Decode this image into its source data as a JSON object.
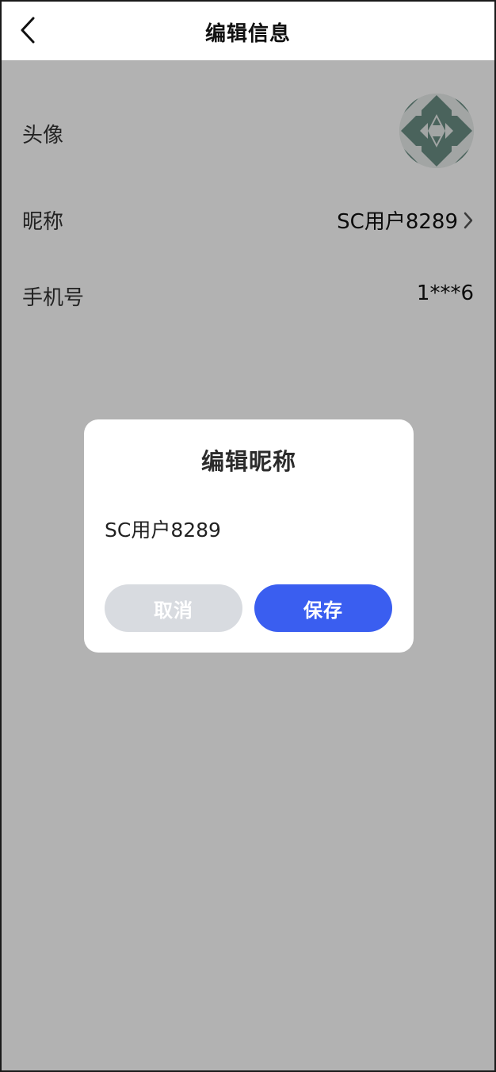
{
  "header": {
    "title": "编辑信息",
    "back_icon": "chevron-left-icon"
  },
  "profile": {
    "avatar_label": "头像",
    "nickname_label": "昵称",
    "nickname_value": "SC用户8289",
    "phone_label": "手机号",
    "phone_value": "1***6"
  },
  "dialog": {
    "title": "编辑昵称",
    "input_value": "SC用户8289",
    "cancel_label": "取消",
    "save_label": "保存"
  },
  "colors": {
    "overlay": "rgba(0,0,0,0.30)",
    "accent": "#3a5ef0",
    "cancel_bg": "#d8dbe0",
    "avatar_pattern": "#6b8f85"
  }
}
